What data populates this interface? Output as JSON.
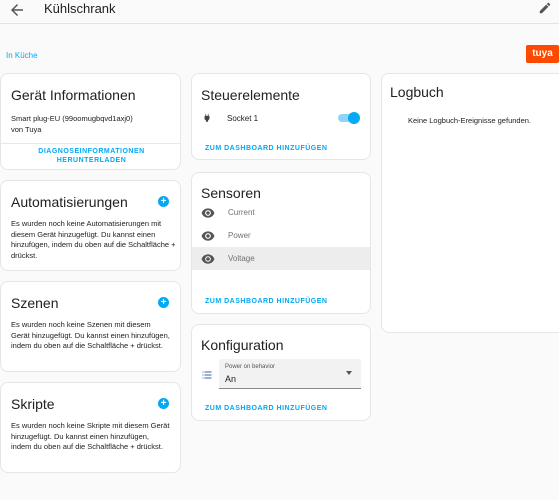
{
  "header": {
    "title": "Kühlschrank"
  },
  "area_link": "In Küche",
  "brand_logo_text": "tuya",
  "device_info": {
    "title": "Gerät Informationen",
    "model": "Smart plug-EU (99oomugbqvd1axj0)",
    "vendor": "von Tuya",
    "download_label_line1": "DIAGNOSEINFORMATIONEN",
    "download_label_line2": "HERUNTERLADEN"
  },
  "automations": {
    "title": "Automatisierungen",
    "text": "Es wurden noch keine Automatisierungen mit diesem Gerät hinzugefügt. Du kannst einen hinzufügen, indem du oben auf die Schaltfläche + drückst."
  },
  "scenes": {
    "title": "Szenen",
    "text": "Es wurden noch keine Szenen mit diesem Gerät hinzugefügt. Du kannst einen hinzufügen, indem du oben auf die Schaltfläche + drückst."
  },
  "scripts": {
    "title": "Skripte",
    "text": "Es wurden noch keine Skripte mit diesem Gerät hinzugefügt. Du kannst einen hinzufügen, indem du oben auf die Schaltfläche + drückst."
  },
  "controls": {
    "title": "Steuerelemente",
    "socket_label": "Socket 1",
    "socket_on": true,
    "add_dashboard": "ZUM DASHBOARD HINZUFÜGEN"
  },
  "sensors": {
    "title": "Sensoren",
    "items": [
      "Current",
      "Power",
      "Voltage"
    ],
    "add_dashboard": "ZUM DASHBOARD HINZUFÜGEN"
  },
  "config": {
    "title": "Konfiguration",
    "select_label": "Power on behavior",
    "select_value": "An",
    "add_dashboard": "ZUM DASHBOARD HINZUFÜGEN"
  },
  "logbook": {
    "title": "Logbuch",
    "empty": "Keine Logbuch-Ereignisse gefunden."
  },
  "colors": {
    "accent": "#03a9f4",
    "brand": "#ff4800"
  }
}
